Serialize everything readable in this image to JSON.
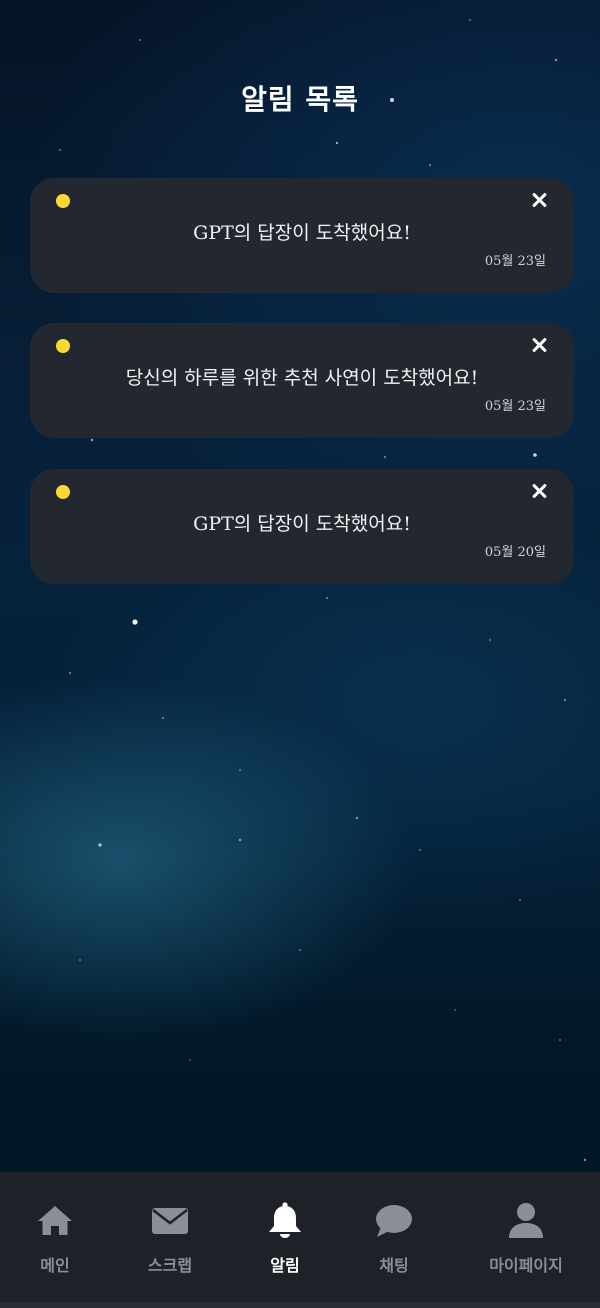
{
  "header": {
    "title": "알림 목록"
  },
  "notifications": [
    {
      "message": "GPT의 답장이 도착했어요!",
      "date": "05월 23일"
    },
    {
      "message": "당신의 하루를 위한 추천 사연이 도착했어요!",
      "date": "05월 23일"
    },
    {
      "message": "GPT의 답장이 도착했어요!",
      "date": "05월 20일"
    }
  ],
  "nav": {
    "items": [
      {
        "label": "메인",
        "icon": "home-icon"
      },
      {
        "label": "스크랩",
        "icon": "mail-icon"
      },
      {
        "label": "알림",
        "icon": "bell-icon",
        "active": true
      },
      {
        "label": "채팅",
        "icon": "chat-bubble-icon"
      },
      {
        "label": "마이페이지",
        "icon": "user-icon"
      }
    ]
  },
  "colors": {
    "unread_dot": "#fdd835",
    "card_bg": "#222730",
    "nav_bg": "#1f2129",
    "nav_inactive": "#8b8e95",
    "nav_active": "#ffffff"
  }
}
